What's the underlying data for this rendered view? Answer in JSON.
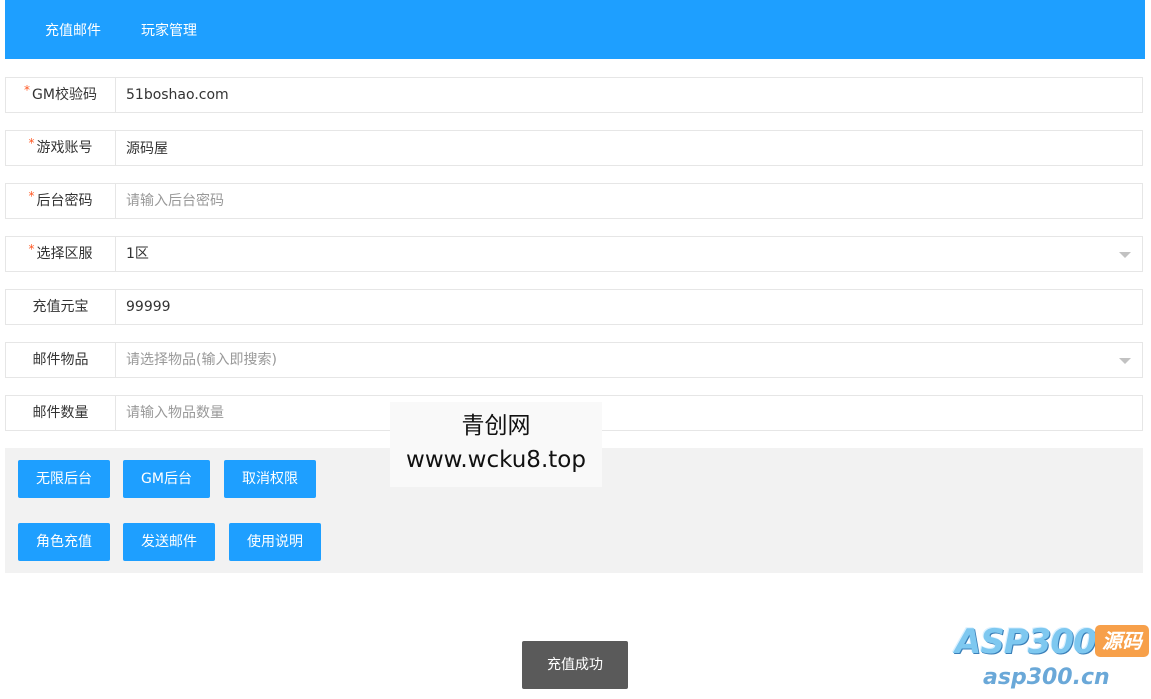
{
  "nav": {
    "tabs": [
      {
        "label": "充值邮件"
      },
      {
        "label": "玩家管理"
      }
    ]
  },
  "form": {
    "gm_code": {
      "label": "GM校验码",
      "required": true,
      "value": "51boshao.com",
      "placeholder": ""
    },
    "account": {
      "label": "游戏账号",
      "required": true,
      "value": "源码屋",
      "placeholder": ""
    },
    "password": {
      "label": "后台密码",
      "required": true,
      "value": "",
      "placeholder": "请输入后台密码"
    },
    "server": {
      "label": "选择区服",
      "required": true,
      "value": "1区",
      "placeholder": ""
    },
    "yuanbao": {
      "label": "充值元宝",
      "required": false,
      "value": "99999",
      "placeholder": ""
    },
    "mail_item": {
      "label": "邮件物品",
      "required": false,
      "value": "",
      "placeholder": "请选择物品(输入即搜索)"
    },
    "mail_qty": {
      "label": "邮件数量",
      "required": false,
      "value": "",
      "placeholder": "请输入物品数量"
    }
  },
  "actions": {
    "row1": [
      "无限后台",
      "GM后台",
      "取消权限"
    ],
    "row2": [
      "角色充值",
      "发送邮件",
      "使用说明"
    ]
  },
  "required_mark": "*",
  "watermark": {
    "line1": "青创网",
    "line2": "www.wcku8.top"
  },
  "toast": {
    "text": "充值成功"
  },
  "logo": {
    "main": "ASP300",
    "badge": "源码",
    "url": "asp300.cn"
  },
  "colors": {
    "primary": "#1E9FFF",
    "required": "#FF5722",
    "panel": "#f2f2f2",
    "toast": "#5a5a5a"
  }
}
